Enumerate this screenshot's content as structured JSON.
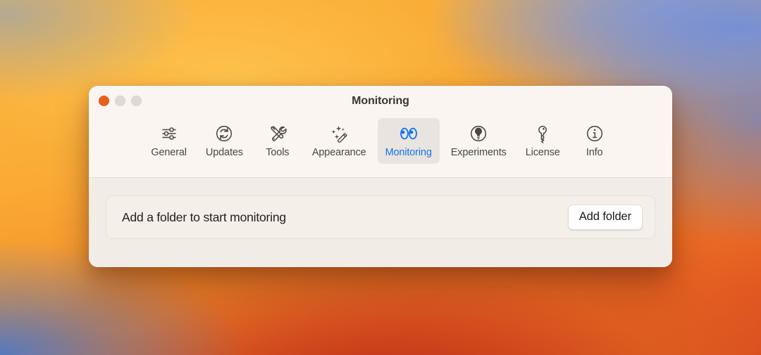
{
  "window": {
    "title": "Monitoring",
    "traffic_lights": [
      {
        "name": "close",
        "color": "#e8601c"
      },
      {
        "name": "minimize",
        "color": "#ded9d5"
      },
      {
        "name": "zoom",
        "color": "#ded9d5"
      }
    ]
  },
  "toolbar": {
    "selected": "Monitoring",
    "accent_color": "#1273f0",
    "selected_bg": "#e9e4df",
    "tabs": [
      {
        "label": "General",
        "icon": "sliders-icon",
        "selected": false
      },
      {
        "label": "Updates",
        "icon": "refresh-icon",
        "selected": false
      },
      {
        "label": "Tools",
        "icon": "tools-icon",
        "selected": false
      },
      {
        "label": "Appearance",
        "icon": "magic-wand-icon",
        "selected": false
      },
      {
        "label": "Monitoring",
        "icon": "eyes-icon",
        "selected": true
      },
      {
        "label": "Experiments",
        "icon": "lightbulb-icon",
        "selected": false
      },
      {
        "label": "License",
        "icon": "key-icon",
        "selected": false
      },
      {
        "label": "Info",
        "icon": "info-icon",
        "selected": false
      }
    ]
  },
  "content": {
    "empty_state_label": "Add a folder to start monitoring",
    "add_folder_label": "Add folder"
  }
}
